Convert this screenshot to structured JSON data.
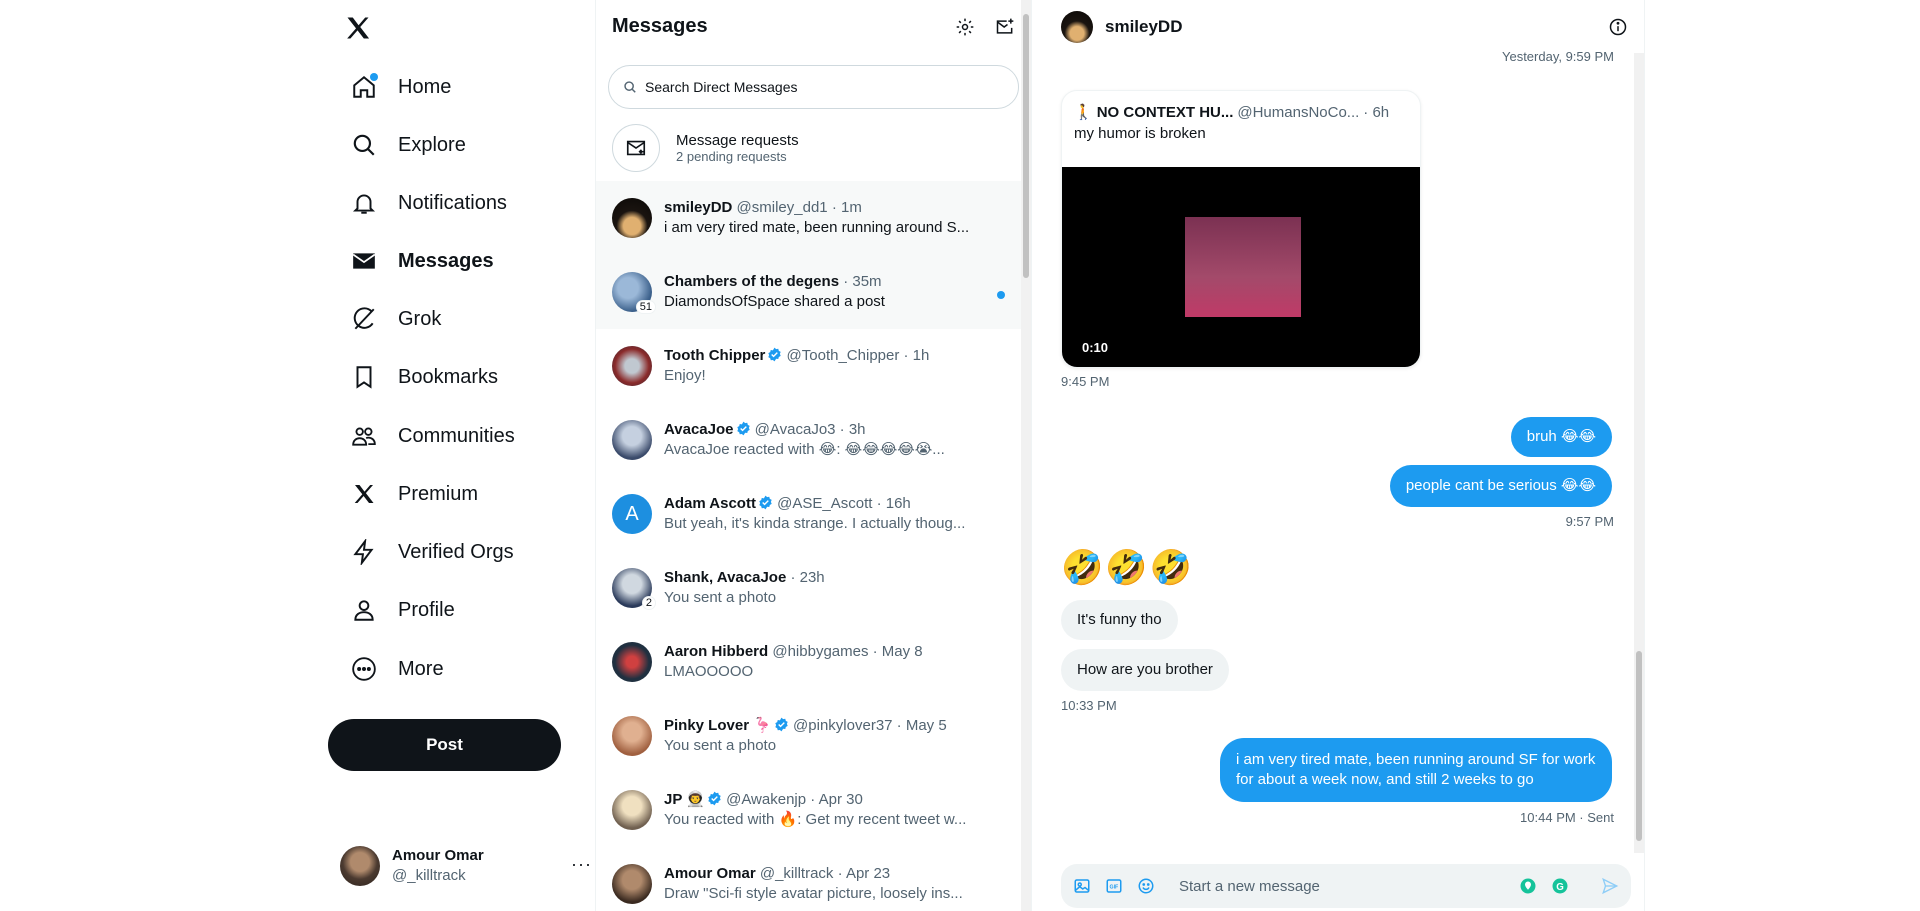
{
  "nav": {
    "items": [
      {
        "label": "Home",
        "icon": "home-icon"
      },
      {
        "label": "Explore",
        "icon": "search-icon"
      },
      {
        "label": "Notifications",
        "icon": "bell-icon"
      },
      {
        "label": "Messages",
        "icon": "envelope-icon"
      },
      {
        "label": "Grok",
        "icon": "grok-icon"
      },
      {
        "label": "Bookmarks",
        "icon": "bookmark-icon"
      },
      {
        "label": "Communities",
        "icon": "communities-icon"
      },
      {
        "label": "Premium",
        "icon": "x-logo-icon"
      },
      {
        "label": "Verified Orgs",
        "icon": "lightning-icon"
      },
      {
        "label": "Profile",
        "icon": "person-icon"
      },
      {
        "label": "More",
        "icon": "more-circle-icon"
      }
    ],
    "post_label": "Post",
    "user": {
      "name": "Amour Omar",
      "handle": "@_killtrack",
      "more": "···"
    }
  },
  "messages": {
    "title": "Messages",
    "search_placeholder": "Search Direct Messages",
    "requests": {
      "title": "Message requests",
      "subtitle": "2 pending requests"
    },
    "conversations": [
      {
        "name": "smileyDD",
        "handle": "@smiley_dd1",
        "time": "· 1m",
        "preview": "i am very tired mate, been running around S...",
        "verified": false
      },
      {
        "name": "Chambers of the degens",
        "handle": "",
        "time": "· 35m",
        "preview": "DiamondsOfSpace shared a post",
        "verified": false,
        "badge": "51"
      },
      {
        "name": "Tooth Chipper",
        "handle": "@Tooth_Chipper",
        "time": "· 1h",
        "preview": "Enjoy!",
        "verified": true
      },
      {
        "name": "AvacaJoe",
        "handle": "@AvacaJo3",
        "time": "· 3h",
        "preview": "AvacaJoe reacted with 😂: 😂😂😂😂😭...",
        "verified": true
      },
      {
        "name": "Adam Ascott",
        "handle": "@ASE_Ascott",
        "time": "· 16h",
        "preview": "But yeah, it's kinda strange. I actually thoug...",
        "verified": true
      },
      {
        "name": "Shank, AvacaJoe",
        "handle": "",
        "time": "· 23h",
        "preview": "You sent a photo",
        "verified": false,
        "badge": "2"
      },
      {
        "name": "Aaron Hibberd",
        "handle": "@hibbygames",
        "time": "· May 8",
        "preview": "LMAOOOOO",
        "verified": false
      },
      {
        "name": "Pinky Lover 🦩",
        "handle": "@pinkylover37",
        "time": "· May 5",
        "preview": "You sent a photo",
        "verified": true
      },
      {
        "name": "JP 👨‍🚀",
        "handle": "@Awakenjp",
        "time": "· Apr 30",
        "preview": "You reacted with 🔥: Get my recent tweet w...",
        "verified": true
      },
      {
        "name": "Amour Omar",
        "handle": "@_killtrack",
        "time": "· Apr 23",
        "preview": "Draw \"Sci-fi style avatar picture, loosely ins...",
        "verified": false
      }
    ]
  },
  "conversation": {
    "name": "smileyDD",
    "top_time": "Yesterday, 9:59 PM",
    "tweet": {
      "name": "NO CONTEXT HU...",
      "handle": "@HumansNoCo...",
      "time": "· 6h",
      "text": "my humor is broken",
      "duration": "0:10"
    },
    "tweet_time": "9:45 PM",
    "out1": [
      "bruh 😂😂",
      "people cant be serious 😂😂"
    ],
    "out1_time": "9:57 PM",
    "emojis": "🤣🤣🤣",
    "in1": [
      "It's funny tho",
      "How are you brother"
    ],
    "in1_time": "10:33 PM",
    "out2": "i am very tired mate, been running around SF for work for about a week now, and still 2 weeks to go",
    "out2_time": "10:44 PM · Sent",
    "composer_placeholder": "Start a new message"
  },
  "colors": {
    "accent": "#1d9bf0",
    "text": "#0f1419",
    "muted": "#536471",
    "bubble_in": "#eff3f4"
  }
}
